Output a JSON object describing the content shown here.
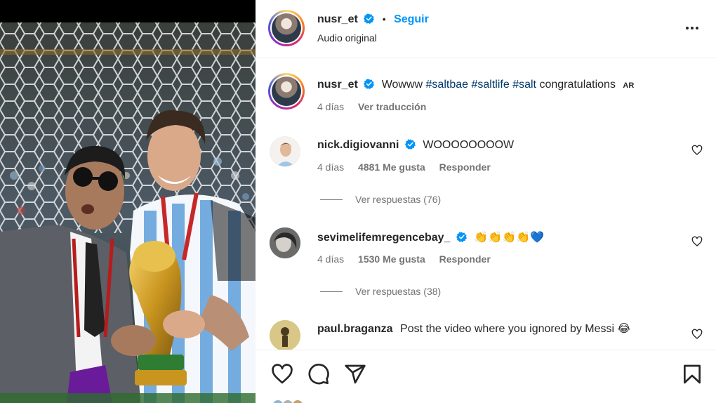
{
  "post": {
    "author": "nusr_et",
    "follow_label": "Seguir",
    "dot": "•",
    "audio": "Audio original"
  },
  "caption": {
    "user": "nusr_et",
    "text_prefix": "Wowww",
    "hashtags": [
      "#saltbae",
      "#saltlife",
      "#salt"
    ],
    "text_suffix": "congratulations",
    "flag": "AR",
    "age": "4 días",
    "translate": "Ver traducción"
  },
  "comments": [
    {
      "user": "nick.digiovanni",
      "verified": true,
      "text": "WOOOOOOOOW",
      "age": "4 días",
      "likes": "4881 Me gusta",
      "reply_label": "Responder",
      "replies_label": "Ver respuestas (76)"
    },
    {
      "user": "sevimelifemregencebay_",
      "verified": true,
      "text": "👏👏👏👏💙",
      "age": "4 días",
      "likes": "1530 Me gusta",
      "reply_label": "Responder",
      "replies_label": "Ver respuestas (38)"
    },
    {
      "user": "paul.braganza",
      "verified": false,
      "text": "Post the video where you ignored by Messi 😂"
    }
  ],
  "icons": {
    "more": "more-options-icon",
    "like": "heart-icon",
    "comment": "comment-icon",
    "share": "share-icon",
    "save": "bookmark-icon",
    "verified": "verified-badge-icon"
  },
  "colors": {
    "accent": "#0095f6",
    "verified": "#0095f6",
    "text": "#262626",
    "secondary": "#737373",
    "hashtag": "#00376b"
  }
}
